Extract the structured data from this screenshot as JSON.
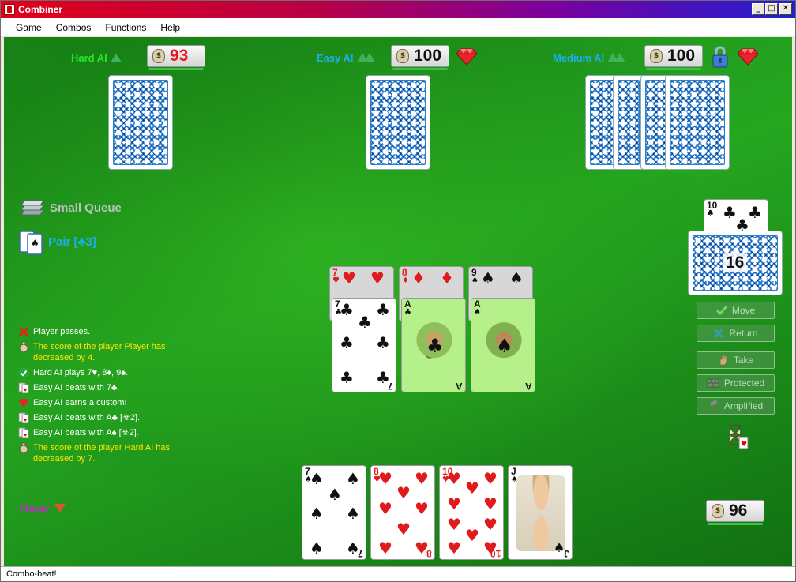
{
  "window": {
    "title": "Combiner"
  },
  "menu": [
    "Game",
    "Combos",
    "Functions",
    "Help"
  ],
  "opponents": [
    {
      "name": "Hard AI",
      "score": "93",
      "score_color": "#e8151b",
      "name_color": "#27e52a",
      "rank_icon": "arrow-up-icon",
      "cards": 1,
      "gem": false,
      "lock": false
    },
    {
      "name": "Easy AI",
      "score": "100",
      "score_color": "#111111",
      "name_color": "#1faee8",
      "rank_icon": "mountain-icon",
      "cards": 1,
      "gem": true,
      "lock": false
    },
    {
      "name": "Medium AI",
      "score": "100",
      "score_color": "#111111",
      "name_color": "#1faee8",
      "rank_icon": "mountain-icon",
      "cards": 4,
      "gem": true,
      "lock": true
    }
  ],
  "queue": {
    "label": "Small Queue"
  },
  "combo": {
    "label": "Pair [♣3]"
  },
  "log": [
    {
      "icon": "cross-icon",
      "text": "Player passes.",
      "color": "white"
    },
    {
      "icon": "moneybag-icon",
      "text": "The score of the player Player has decreased by 4.",
      "color": "yellow"
    },
    {
      "icon": "check-icon",
      "text": "Hard AI plays 7♥, 8♦, 9♠.",
      "color": "white"
    },
    {
      "icon": "cards-icon",
      "text": "Easy AI beats with 7♣.",
      "color": "white"
    },
    {
      "icon": "gem-icon",
      "text": "Easy AI earns a custom!",
      "color": "white"
    },
    {
      "icon": "cards-icon",
      "text": "Easy AI beats with A♣ [☣2].",
      "color": "white"
    },
    {
      "icon": "cards-icon",
      "text": "Easy AI beats with A♠ [☣2].",
      "color": "white"
    },
    {
      "icon": "moneybag-icon",
      "text": "The score of the player Hard AI has decreased by 7.",
      "color": "yellow"
    }
  ],
  "table_attack": [
    {
      "rank": "7",
      "suit": "♥",
      "color": "red"
    },
    {
      "rank": "8",
      "suit": "♦",
      "color": "red"
    },
    {
      "rank": "9",
      "suit": "♠",
      "color": "blk"
    }
  ],
  "table_defense": [
    {
      "rank": "7",
      "suit": "♣",
      "color": "blk",
      "style": "plain"
    },
    {
      "rank": "A",
      "suit": "♣",
      "color": "blk",
      "style": "green"
    },
    {
      "rank": "A",
      "suit": "♠",
      "color": "blk",
      "style": "green"
    }
  ],
  "trump_card": {
    "rank": "10",
    "suit": "♣"
  },
  "deck_count": "16",
  "actions": [
    {
      "label": "Move",
      "icon": "check-icon"
    },
    {
      "label": "Return",
      "icon": "cross-icon"
    },
    {
      "label": "Take",
      "icon": "hand-icon"
    },
    {
      "label": "Protected",
      "icon": "wall-icon"
    },
    {
      "label": "Amplified",
      "icon": "hammer-icon"
    }
  ],
  "player": {
    "name": "Player",
    "score": "96",
    "name_color": "#d01ed8"
  },
  "hand": [
    {
      "rank": "7",
      "suit": "♠",
      "color": "blk"
    },
    {
      "rank": "8",
      "suit": "♥",
      "color": "red"
    },
    {
      "rank": "10",
      "suit": "♥",
      "color": "red"
    },
    {
      "rank": "J",
      "suit": "♠",
      "color": "blk"
    }
  ],
  "status": "Combo-beat!"
}
